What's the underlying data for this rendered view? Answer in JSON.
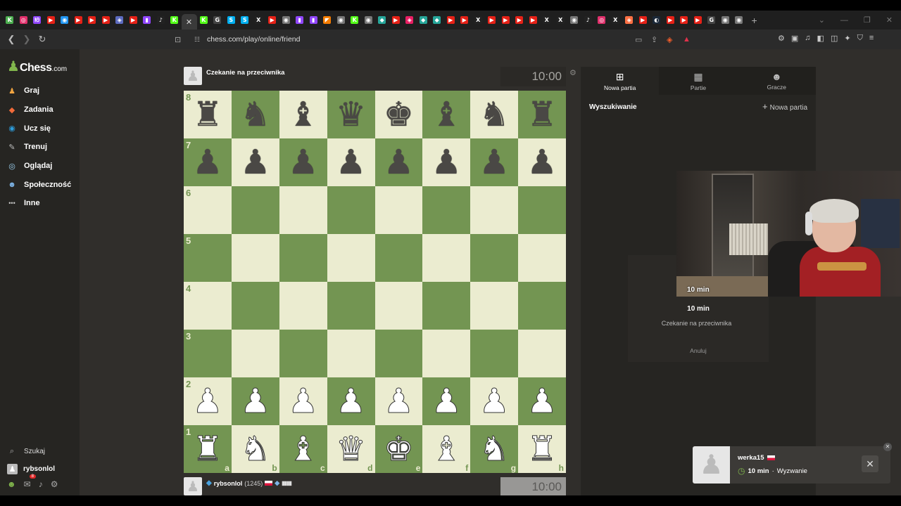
{
  "browser": {
    "url": "chess.com/play/online/friend",
    "tabs": [
      {
        "icon": "chesscom-icon",
        "glyph": "K",
        "color": "#4caf50"
      },
      {
        "icon": "instagram-icon",
        "glyph": "◎",
        "color": "#e1306c"
      },
      {
        "icon": "twitch-icon",
        "glyph": "ᘚ",
        "color": "#9146ff"
      },
      {
        "icon": "youtube-icon",
        "glyph": "▶",
        "color": "#e62117"
      },
      {
        "icon": "web-icon",
        "glyph": "◉",
        "color": "#2196f3"
      },
      {
        "icon": "youtube-icon",
        "glyph": "▶",
        "color": "#e62117"
      },
      {
        "icon": "youtube-icon",
        "glyph": "▶",
        "color": "#e62117"
      },
      {
        "icon": "youtube-icon",
        "glyph": "▶",
        "color": "#e62117"
      },
      {
        "icon": "app-icon",
        "glyph": "◈",
        "color": "#5c6bc0"
      },
      {
        "icon": "youtube-icon",
        "glyph": "▶",
        "color": "#e62117"
      },
      {
        "icon": "twitch-icon",
        "glyph": "▮",
        "color": "#9146ff"
      },
      {
        "icon": "tiktok-icon",
        "glyph": "♪",
        "color": "#222"
      },
      {
        "icon": "kick-icon",
        "glyph": "K",
        "color": "#53fc18"
      },
      {
        "icon": "close-tab-icon",
        "glyph": "✕",
        "color": "#ddd",
        "active": true
      },
      {
        "icon": "kick-icon",
        "glyph": "K",
        "color": "#53fc18"
      },
      {
        "icon": "google-icon",
        "glyph": "G",
        "color": "#444"
      },
      {
        "icon": "skype-icon",
        "glyph": "S",
        "color": "#00aff0"
      },
      {
        "icon": "skype-icon",
        "glyph": "S",
        "color": "#00aff0"
      },
      {
        "icon": "x-icon",
        "glyph": "X",
        "color": "#222"
      },
      {
        "icon": "youtube-icon",
        "glyph": "▶",
        "color": "#e62117"
      },
      {
        "icon": "web-icon",
        "glyph": "◉",
        "color": "#777"
      },
      {
        "icon": "twitch-icon",
        "glyph": "▮",
        "color": "#9146ff"
      },
      {
        "icon": "twitch-icon",
        "glyph": "▮",
        "color": "#9146ff"
      },
      {
        "icon": "app-icon",
        "glyph": "◤",
        "color": "#f57c00"
      },
      {
        "icon": "web-icon",
        "glyph": "◉",
        "color": "#777"
      },
      {
        "icon": "kick-icon",
        "glyph": "K",
        "color": "#53fc18"
      },
      {
        "icon": "web-icon",
        "glyph": "◉",
        "color": "#777"
      },
      {
        "icon": "app-icon",
        "glyph": "◆",
        "color": "#26a69a"
      },
      {
        "icon": "youtube-icon",
        "glyph": "▶",
        "color": "#e62117"
      },
      {
        "icon": "app-icon",
        "glyph": "◈",
        "color": "#e91e63"
      },
      {
        "icon": "app-icon",
        "glyph": "◆",
        "color": "#26a69a"
      },
      {
        "icon": "app-icon",
        "glyph": "◆",
        "color": "#26a69a"
      },
      {
        "icon": "youtube-icon",
        "glyph": "▶",
        "color": "#e62117"
      },
      {
        "icon": "youtube-icon",
        "glyph": "▶",
        "color": "#e62117"
      },
      {
        "icon": "x-icon",
        "glyph": "X",
        "color": "#222"
      },
      {
        "icon": "youtube-icon",
        "glyph": "▶",
        "color": "#e62117"
      },
      {
        "icon": "youtube-icon",
        "glyph": "▶",
        "color": "#e62117"
      },
      {
        "icon": "youtube-icon",
        "glyph": "▶",
        "color": "#e62117"
      },
      {
        "icon": "youtube-icon",
        "glyph": "▶",
        "color": "#e62117"
      },
      {
        "icon": "x-icon",
        "glyph": "X",
        "color": "#222"
      },
      {
        "icon": "x-icon",
        "glyph": "X",
        "color": "#222"
      },
      {
        "icon": "web-icon",
        "glyph": "◉",
        "color": "#777"
      },
      {
        "icon": "tiktok-icon",
        "glyph": "♪",
        "color": "#222"
      },
      {
        "icon": "instagram-icon",
        "glyph": "◎",
        "color": "#e1306c"
      },
      {
        "icon": "x-icon",
        "glyph": "X",
        "color": "#222"
      },
      {
        "icon": "app-icon",
        "glyph": "◈",
        "color": "#ff7043"
      },
      {
        "icon": "youtube-icon",
        "glyph": "▶",
        "color": "#e62117"
      },
      {
        "icon": "steam-icon",
        "glyph": "◐",
        "color": "#1b2838"
      },
      {
        "icon": "youtube-icon",
        "glyph": "▶",
        "color": "#e62117"
      },
      {
        "icon": "youtube-icon",
        "glyph": "▶",
        "color": "#e62117"
      },
      {
        "icon": "youtube-icon",
        "glyph": "▶",
        "color": "#e62117"
      },
      {
        "icon": "google-icon",
        "glyph": "G",
        "color": "#444"
      },
      {
        "icon": "web-icon",
        "glyph": "◉",
        "color": "#777"
      },
      {
        "icon": "web-icon",
        "glyph": "◉",
        "color": "#777"
      }
    ]
  },
  "logo": {
    "text": "Chess",
    "suffix": ".com"
  },
  "sidebar": {
    "items": [
      {
        "label": "Graj",
        "icon": "play-icon",
        "glyph": "♟",
        "color": "#f2a541"
      },
      {
        "label": "Zadania",
        "icon": "puzzle-icon",
        "glyph": "◆",
        "color": "#f26b3a"
      },
      {
        "label": "Ucz się",
        "icon": "learn-icon",
        "glyph": "◉",
        "color": "#2d9cdb"
      },
      {
        "label": "Trenuj",
        "icon": "train-icon",
        "glyph": "✎",
        "color": "#bbbbbb"
      },
      {
        "label": "Oglądaj",
        "icon": "watch-icon",
        "glyph": "◎",
        "color": "#9fd4f5"
      },
      {
        "label": "Społeczność",
        "icon": "social-icon",
        "glyph": "☻",
        "color": "#7db4e6"
      },
      {
        "label": "Inne",
        "icon": "more-icon",
        "glyph": "•••",
        "color": "#cccccc"
      }
    ],
    "search_label": "Szukaj",
    "username": "rybsonlol",
    "notif_count": "8"
  },
  "game": {
    "top_player": "Czekanie na przeciwnika",
    "top_clock": "10:00",
    "bottom_player": "rybsonlol",
    "bottom_rating": "(1245)",
    "bottom_clock": "10:00",
    "board": [
      [
        "r",
        "n",
        "b",
        "q",
        "k",
        "b",
        "n",
        "r"
      ],
      [
        "p",
        "p",
        "p",
        "p",
        "p",
        "p",
        "p",
        "p"
      ],
      [
        "",
        "",
        "",
        "",
        "",
        "",
        "",
        ""
      ],
      [
        "",
        "",
        "",
        "",
        "",
        "",
        "",
        ""
      ],
      [
        "",
        "",
        "",
        "",
        "",
        "",
        "",
        ""
      ],
      [
        "",
        "",
        "",
        "",
        "",
        "",
        "",
        ""
      ],
      [
        "P",
        "P",
        "P",
        "P",
        "P",
        "P",
        "P",
        "P"
      ],
      [
        "R",
        "N",
        "B",
        "Q",
        "K",
        "B",
        "N",
        "R"
      ]
    ],
    "ranks": [
      "8",
      "7",
      "6",
      "5",
      "4",
      "3",
      "2",
      "1"
    ],
    "files": [
      "a",
      "b",
      "c",
      "d",
      "e",
      "f",
      "g",
      "h"
    ]
  },
  "panel": {
    "tabs": [
      {
        "label": "Nowa partia",
        "icon": "plus-square-icon",
        "glyph": "⊞"
      },
      {
        "label": "Partie",
        "icon": "board-icon",
        "glyph": "▦"
      },
      {
        "label": "Gracze",
        "icon": "players-icon",
        "glyph": "☻"
      }
    ],
    "section_title": "Wyszukiwanie",
    "new_game": "Nowa partia",
    "seek_time": "10 min",
    "seek_status": "Czekanie na przeciwnika",
    "cancel": "Anuluj"
  },
  "webcam": {
    "label": "10 min"
  },
  "toast": {
    "name": "werka15",
    "time": "10 min",
    "sep": "·",
    "type": "Wyzwanie"
  }
}
